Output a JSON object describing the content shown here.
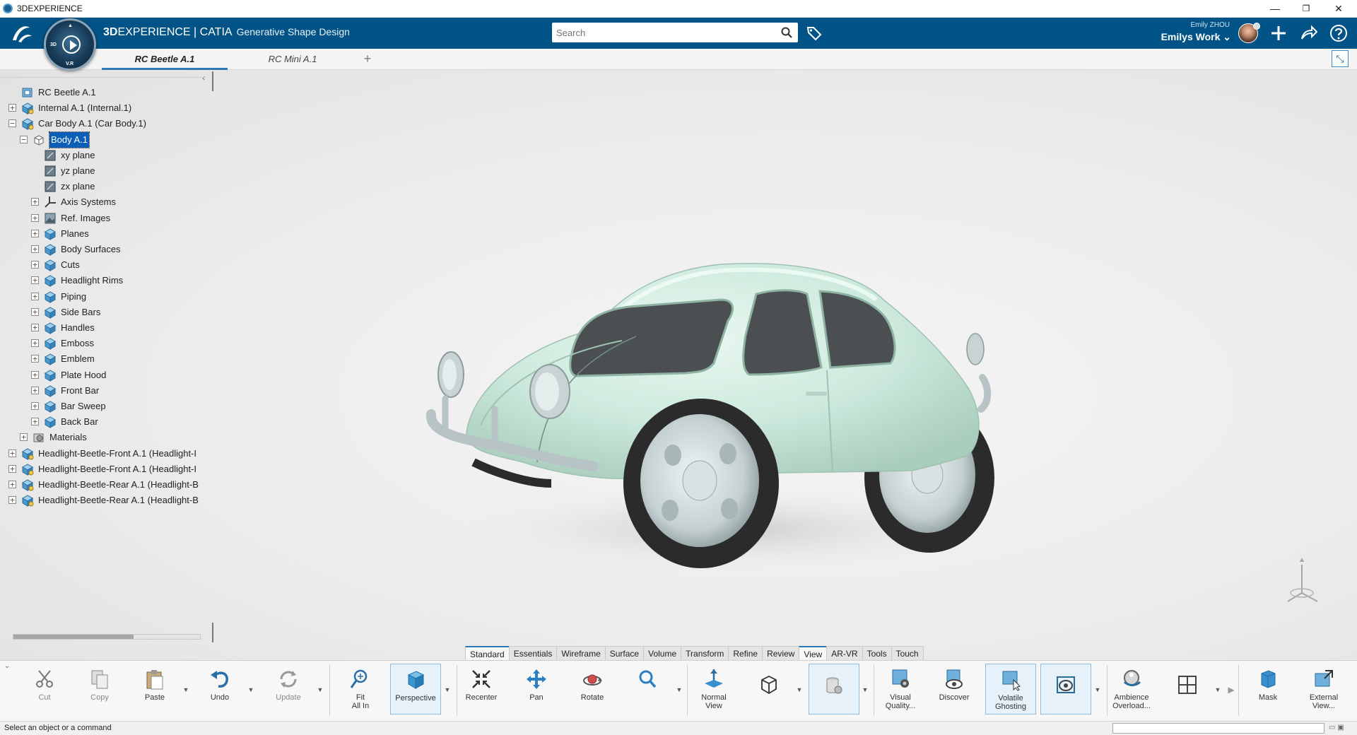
{
  "window": {
    "title": "3DEXPERIENCE",
    "minimize": "—",
    "restore": "❐",
    "close": "✕"
  },
  "header": {
    "brand_3d": "3D",
    "brand_rest": "EXPERIENCE | CATIA",
    "app_name": "Generative Shape Design",
    "search_placeholder": "Search",
    "user_name": "Emily ZHOU",
    "workspace": "Emilys Work ⌄",
    "compass_label": "V.R",
    "compass_3d": "3D",
    "icons": [
      "search-icon",
      "tag-icon",
      "plus-icon",
      "share-icon",
      "help-icon"
    ]
  },
  "tabs": {
    "items": [
      {
        "label": "RC Beetle A.1",
        "active": true
      },
      {
        "label": "RC Mini A.1",
        "active": false
      }
    ],
    "add": "+"
  },
  "tree": {
    "collapse": "‹",
    "nodes": [
      {
        "label": "RC Beetle A.1",
        "icon": "product-icon"
      },
      {
        "label": "Internal A.1 (Internal.1)",
        "icon": "part-instance-icon"
      },
      {
        "label": "Car Body A.1 (Car Body.1)",
        "icon": "part-instance-icon"
      },
      {
        "label": "Body A.1",
        "icon": "part-body-icon"
      },
      {
        "label": "xy plane",
        "icon": "plane-icon"
      },
      {
        "label": "yz plane",
        "icon": "plane-icon"
      },
      {
        "label": "zx plane",
        "icon": "plane-icon"
      },
      {
        "label": "Axis Systems",
        "icon": "axis-system-icon"
      },
      {
        "label": "Ref. Images",
        "icon": "image-icon"
      },
      {
        "label": "Planes",
        "icon": "geometric-set-icon"
      },
      {
        "label": "Body Surfaces",
        "icon": "geometric-set-icon"
      },
      {
        "label": "Cuts",
        "icon": "geometric-set-icon"
      },
      {
        "label": "Headlight Rims",
        "icon": "geometric-set-icon"
      },
      {
        "label": "Piping",
        "icon": "geometric-set-icon"
      },
      {
        "label": "Side Bars",
        "icon": "geometric-set-icon"
      },
      {
        "label": "Handles",
        "icon": "geometric-set-icon"
      },
      {
        "label": "Emboss",
        "icon": "geometric-set-icon"
      },
      {
        "label": "Emblem",
        "icon": "geometric-set-icon"
      },
      {
        "label": "Plate Hood",
        "icon": "geometric-set-icon"
      },
      {
        "label": "Front Bar",
        "icon": "geometric-set-icon"
      },
      {
        "label": "Bar Sweep",
        "icon": "geometric-set-icon"
      },
      {
        "label": "Back Bar",
        "icon": "geometric-set-icon"
      },
      {
        "label": "Materials",
        "icon": "materials-icon"
      },
      {
        "label": "Headlight-Beetle-Front A.1 (Headlight-I",
        "icon": "part-instance-icon"
      },
      {
        "label": "Headlight-Beetle-Front A.1 (Headlight-I",
        "icon": "part-instance-icon"
      },
      {
        "label": "Headlight-Beetle-Rear A.1 (Headlight-B",
        "icon": "part-instance-icon"
      },
      {
        "label": "Headlight-Beetle-Rear A.1 (Headlight-B",
        "icon": "part-instance-icon"
      }
    ]
  },
  "section_tabs": [
    "Standard",
    "Essentials",
    "Wireframe",
    "Surface",
    "Volume",
    "Transform",
    "Refine",
    "Review",
    "View",
    "AR-VR",
    "Tools",
    "Touch"
  ],
  "section_active": "View",
  "toolbar": {
    "cut": "Cut",
    "copy": "Copy",
    "paste": "Paste",
    "undo": "Undo",
    "update": "Update",
    "fit_all_in": "Fit\nAll In",
    "perspective": "Perspective",
    "recenter": "Recenter",
    "pan": "Pan",
    "rotate": "Rotate",
    "normal_view": "Normal\nView",
    "visual_quality": "Visual\nQuality...",
    "discover": "Discover",
    "volatile_ghosting": "Volatile\nGhosting",
    "ambience_overload": "Ambience\nOverload...",
    "mask": "Mask",
    "external_view": "External\nView..."
  },
  "status": {
    "message": "Select an object or a command"
  },
  "colors": {
    "header_bg": "#005386",
    "accent": "#2c79b5",
    "selection": "#0a5eb8",
    "car_body": "#cdeadd"
  }
}
